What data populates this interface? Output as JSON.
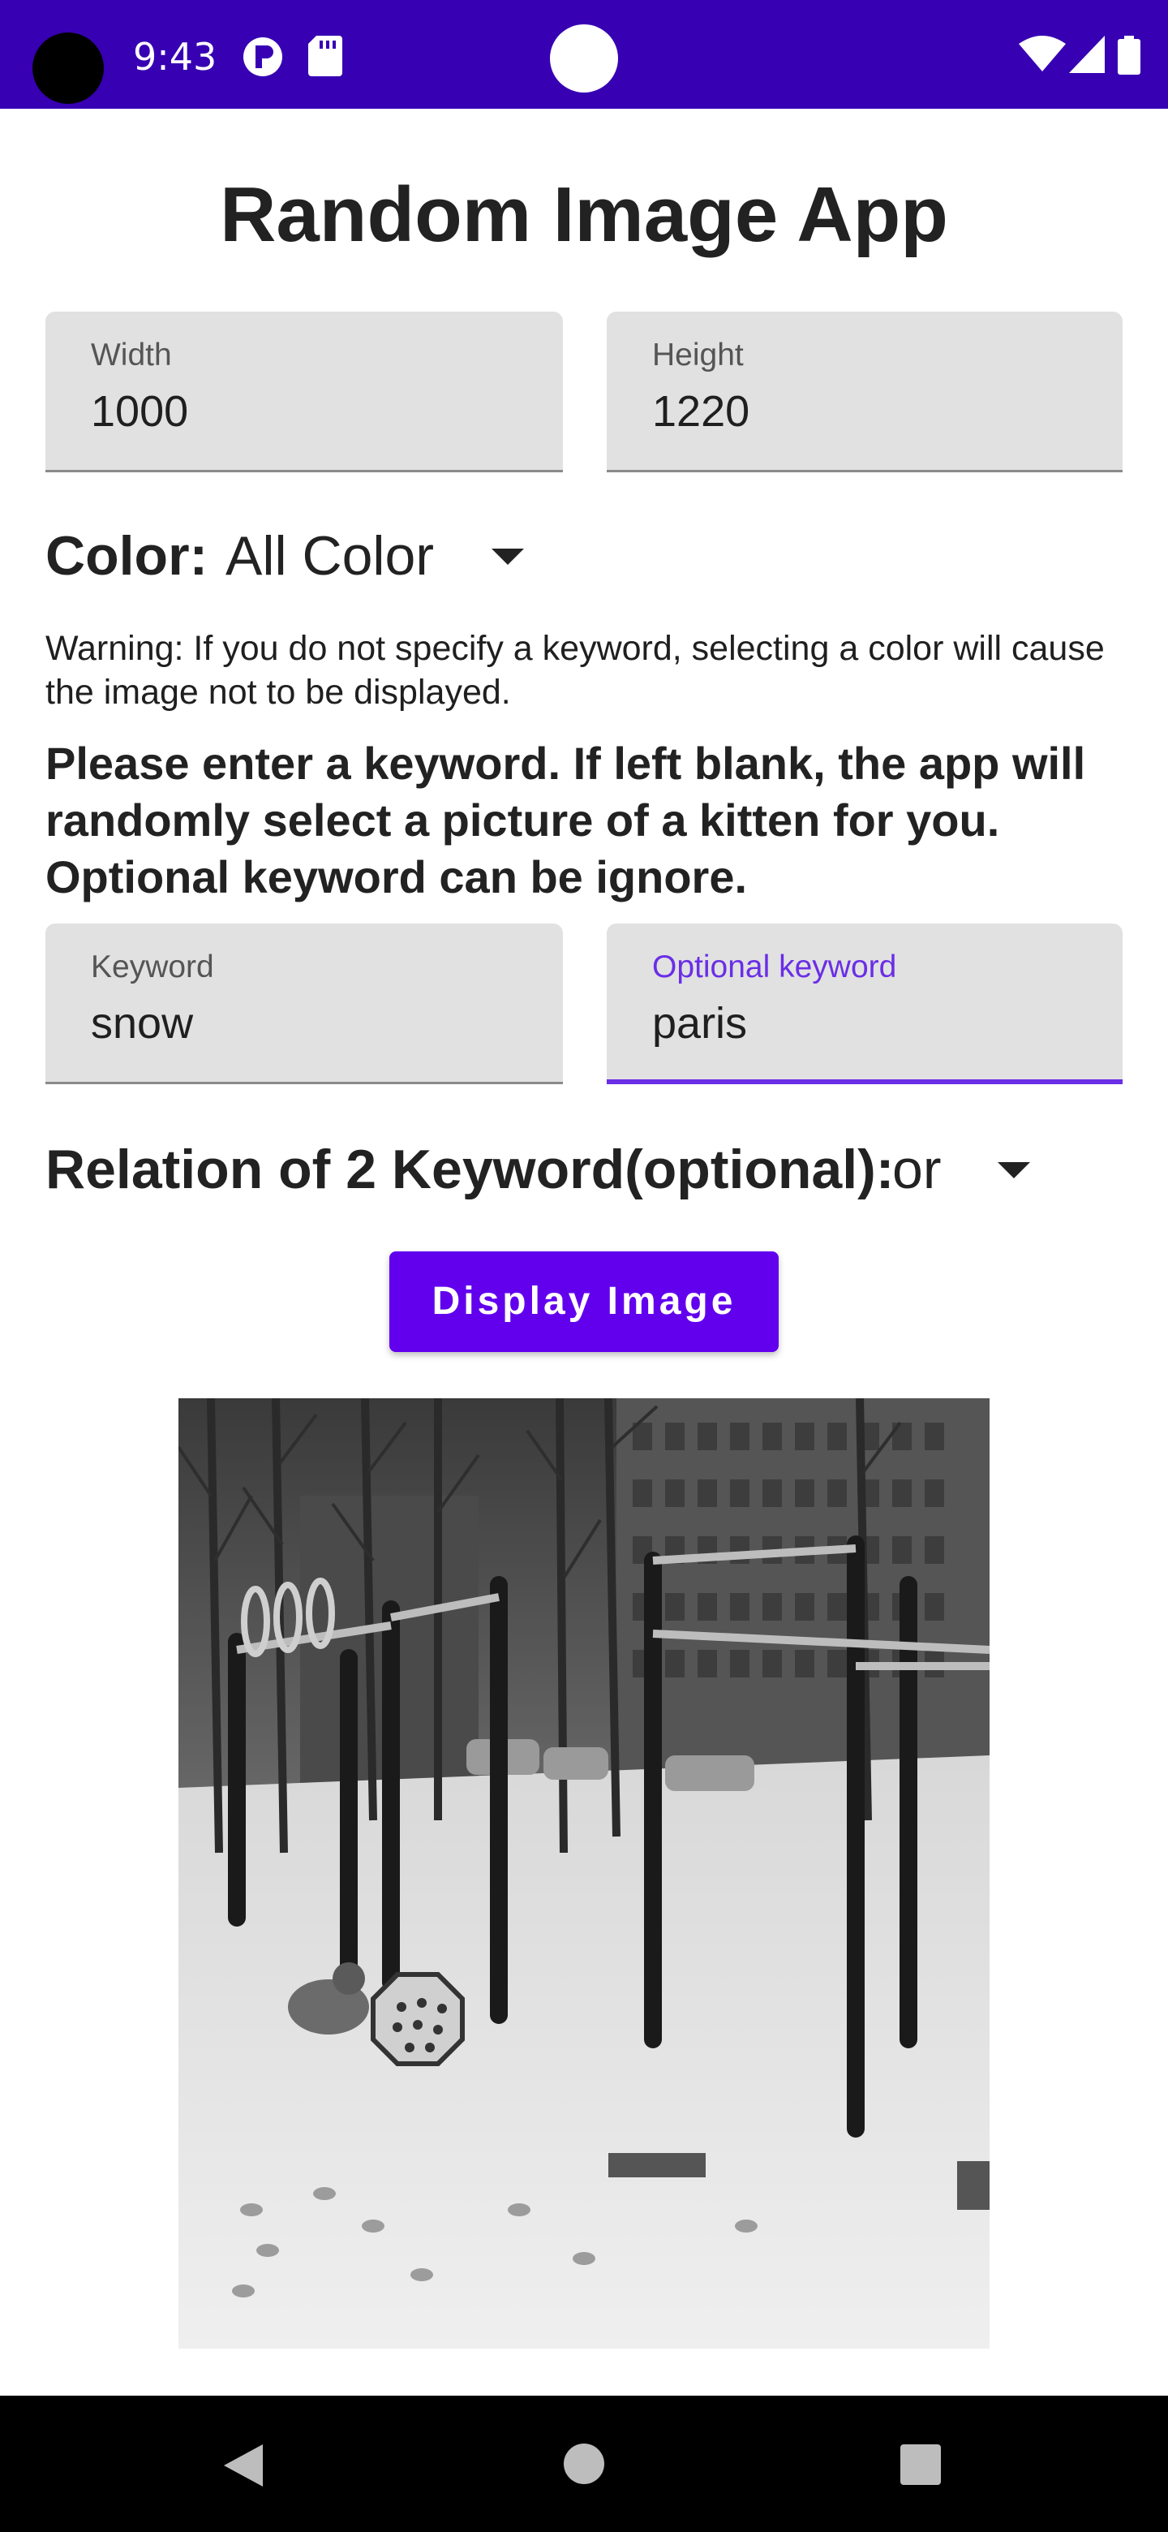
{
  "status_bar": {
    "time": "9:43"
  },
  "title": "Random Image App",
  "size_fields": {
    "width": {
      "label": "Width",
      "value": "1000"
    },
    "height": {
      "label": "Height",
      "value": "1220"
    }
  },
  "color": {
    "label": "Color:",
    "selected": "All Color"
  },
  "warning": "Warning: If you do not specify a keyword, selecting a color will cause the image not to be displayed.",
  "prompt": "Please enter a keyword. If left blank, the app will randomly select a picture of a kitten for you. Optional keyword can be ignore.",
  "keyword_fields": {
    "keyword": {
      "label": "Keyword",
      "value": "snow"
    },
    "optional_keyword": {
      "label": "Optional keyword",
      "value": "paris"
    }
  },
  "relation": {
    "label": "Relation of 2 Keyword(optional):",
    "selected": "or"
  },
  "display_button_label": "Display Image",
  "colors": {
    "status_bar": "#3700b3",
    "accent": "#6200ee",
    "focus": "#6a2ee6",
    "field_bg": "#e1e1e1"
  },
  "icons": [
    "wifi-icon",
    "signal-icon",
    "back-icon",
    "home-icon",
    "recents-icon"
  ]
}
